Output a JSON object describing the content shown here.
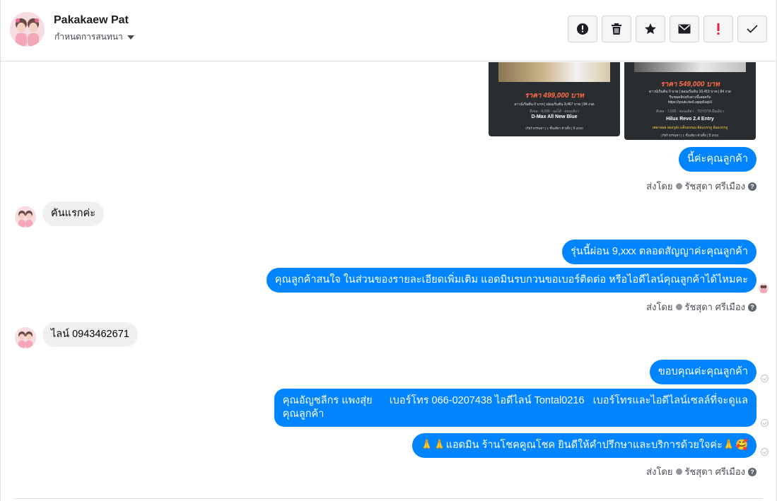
{
  "header": {
    "contact_name": "Pakakaew Pat",
    "subtitle": "กำหนดการสนทนา",
    "actions": [
      {
        "id": "spam",
        "icon": "alert-circle-icon"
      },
      {
        "id": "delete",
        "icon": "trash-icon"
      },
      {
        "id": "star",
        "icon": "star-icon"
      },
      {
        "id": "unread",
        "icon": "envelope-icon"
      },
      {
        "id": "follow-up",
        "icon": "exclamation-icon"
      },
      {
        "id": "done",
        "icon": "checkmark-icon"
      }
    ]
  },
  "cards": [
    {
      "price": "ราคา 499,000 บาท",
      "terms": "ดาวน์เริ่มต้น 0 บาท | ผ่อนเริ่มต้น 9,467 บาท | 84 งวด",
      "meta": "ดีเซล · 4,095 · ออโต้ · ตอนเดียว",
      "model": "D-Max All New Blue",
      "footer": "เกียร์ ธรรมดา | 1 ชั้นเดียว ตัวเตี้ย | ปี 2020"
    },
    {
      "price": "ราคา 549,000 บาท",
      "terms": "ดาวน์เริ่มต้น 0 บาท | ผ่อนเริ่มต้น 10,415 บาท | 84 งวด",
      "note": "รีบชมคลิปจริงล่างนี้เลยครับ",
      "link": "https://youtu.be/Lsqop6uqIU",
      "meta": "ดีเซล · 7,695 · ตอนเดียว · TOYOTA มือเดียว",
      "model": "Hilux Revo 2.4 Entry",
      "location": "เพลาลอย ลองรูส่ง แค็บแหนม ล้อแบรรถู ล้อแบรรถู",
      "footer": "เกียร์ ธรรมดา | 1 ชั้นเดียว ตัวเตี้ย | ปี 2021"
    }
  ],
  "messages": {
    "m1": "นี้ค่ะคุณลูกค้า",
    "m2": "คันแรกค่ะ",
    "m3": "รุ่นนี้ผ่อน  9,xxx ตลอดสัญญาค่ะคุณลูกค้า",
    "m4": "คุณลูกค้าสนใจ ในส่วนของรายละเอียดเพิ่มเติม แอดมินรบกวนขอเบอร์ติดต่อ หรือไอดีไลน์คุณลูกค้าได้ไหมคะ",
    "m5": "ไลน์ 0943462671",
    "m6": "ขอบคุณค่ะคุณลูกค้า",
    "m7_line1": "คุณอัญชลีกร แพงสุ่ย      เบอร์โทร 066-0207438 ไอดีไลน์ Tontal0216   เบอร์โทรและไอดีไลน์เซลล์ที่จะดูแล",
    "m7_line2": "คุณลูกค้า",
    "m8": "🙏🙏แอดมิน ร้านโชคคูณโชค ยินดีให้คำปรึกษาและบริการด้วยใจค่ะ🙏🥰"
  },
  "sent_by": {
    "prefix": "ส่งโดย",
    "agent": "รัชสุดา ศรีเมือง",
    "help": "?"
  },
  "colors": {
    "outgoing_bubble": "#0084ff",
    "incoming_bubble": "#f1f0f0",
    "follow_up_red": "#e41e3f"
  }
}
